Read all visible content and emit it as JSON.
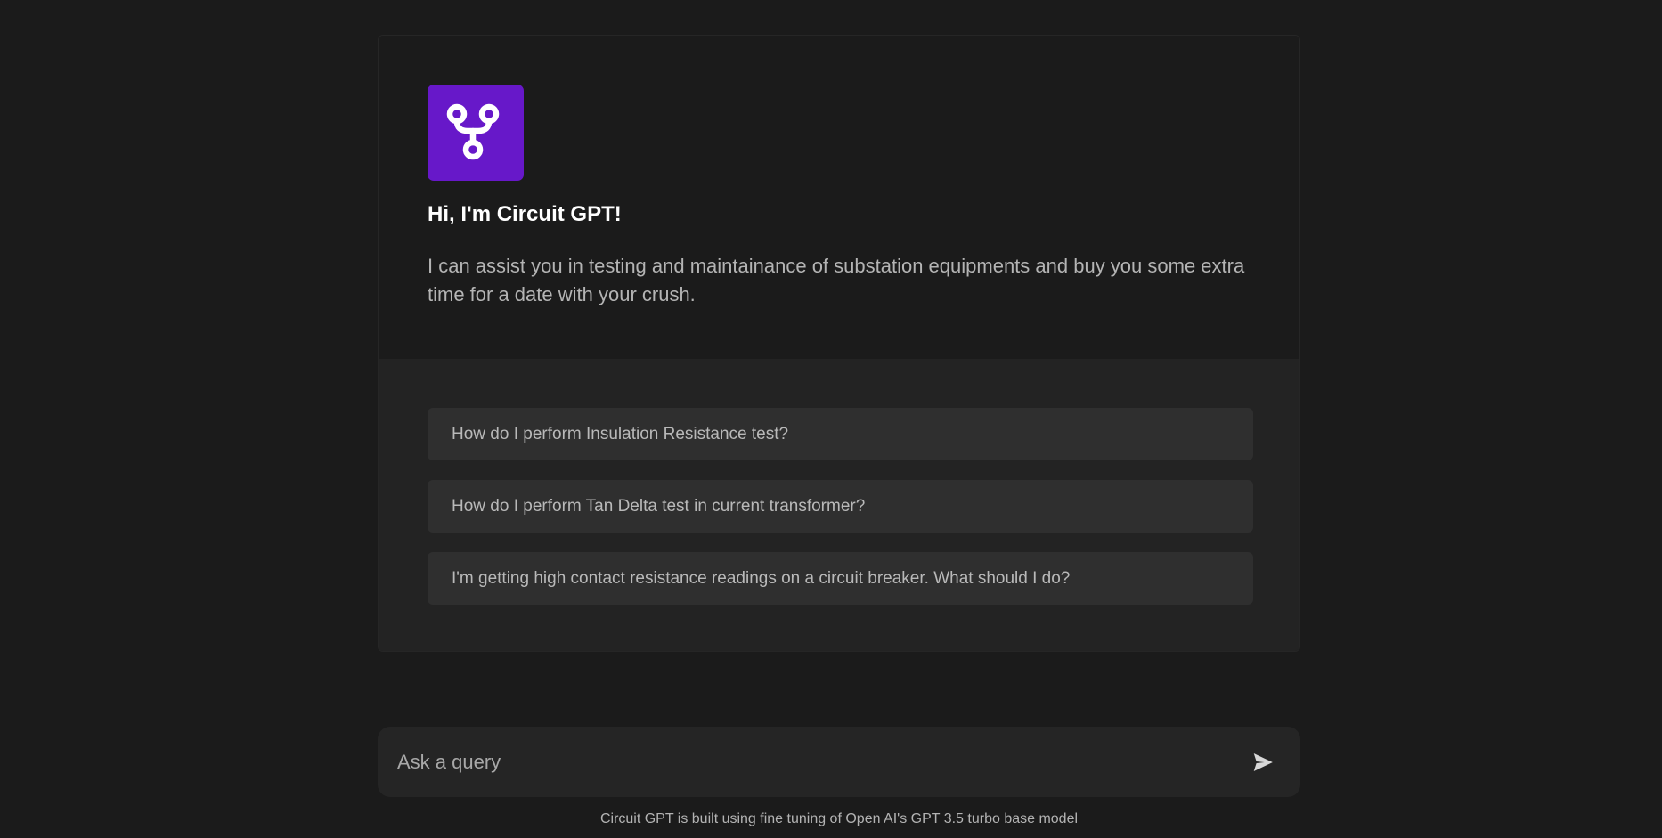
{
  "app": {
    "logo_icon": "git-branch-icon",
    "logo_color": "#6718c9",
    "title": "Hi, I'm Circuit GPT!",
    "intro": "I can assist you in testing and maintainance of substation equipments and buy you some extra time for a date with your crush."
  },
  "suggestions": [
    {
      "label": "How do I perform Insulation Resistance test?"
    },
    {
      "label": "How do I perform Tan Delta test in current transformer?"
    },
    {
      "label": "I'm getting high contact resistance readings on a circuit breaker. What should I do?"
    }
  ],
  "composer": {
    "placeholder": "Ask a query",
    "value": "",
    "send_icon": "send-icon"
  },
  "footer": {
    "text": "Circuit GPT is built using fine tuning of Open AI's GPT 3.5 turbo base model"
  }
}
